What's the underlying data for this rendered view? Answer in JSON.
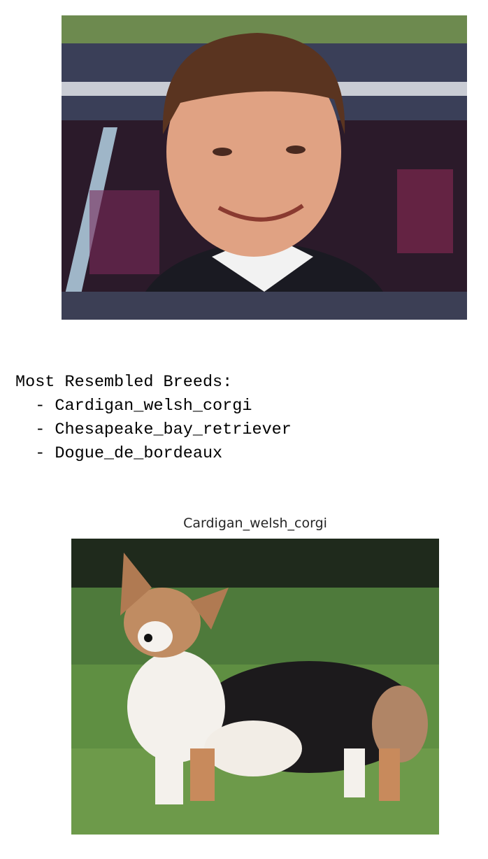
{
  "output_text": {
    "heading": "Most Resembled Breeds:",
    "bullet": "  - ",
    "breeds": [
      "Cardigan_welsh_corgi",
      "Chesapeake_bay_retriever",
      "Dogue_de_bordeaux"
    ]
  },
  "breed_plot": {
    "title": "Cardigan_welsh_corgi"
  }
}
